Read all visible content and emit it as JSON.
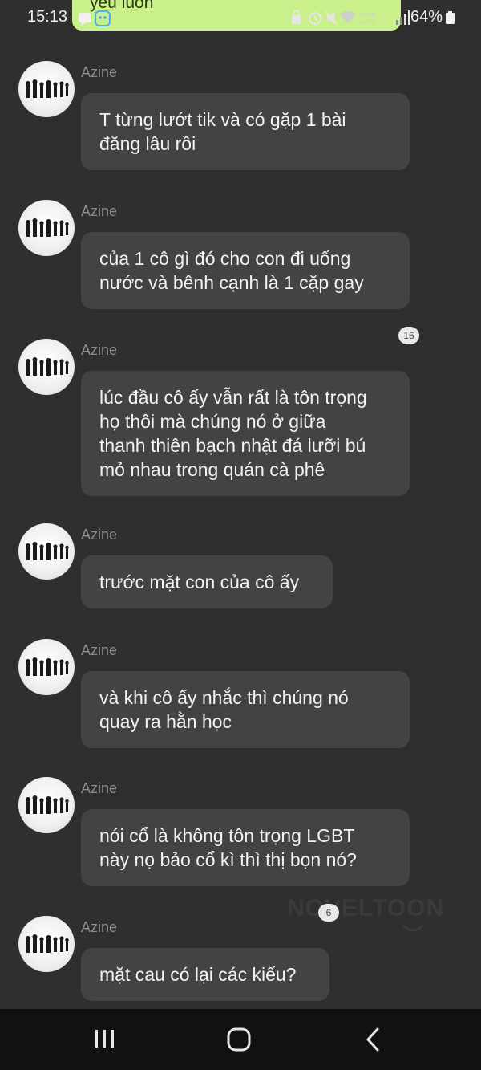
{
  "status_bar": {
    "time": "15:13",
    "banner_text": "yêu luôn",
    "battery": "64%",
    "network_label": "VoLTE2"
  },
  "messages": [
    {
      "sender": "Azine",
      "lines": [
        "T từng lướt tik và có gặp 1 bài",
        "đăng lâu rồi"
      ]
    },
    {
      "sender": "Azine",
      "lines": [
        "của 1 cô gì đó cho con đi uống",
        "nước và bênh cạnh là 1 cặp gay"
      ]
    },
    {
      "sender": "Azine",
      "lines": [
        "lúc đầu cô ấy vẫn rất là tôn trọng",
        "họ thôi mà chúng nó ở giữa",
        "thanh thiên bạch nhật đá lưỡi bú",
        "mỏ nhau trong quán cà phê"
      ],
      "badge": "16"
    },
    {
      "sender": "Azine",
      "lines": [
        "trước mặt con của cô ấy"
      ]
    },
    {
      "sender": "Azine",
      "lines": [
        "và khi cô ấy nhắc thì chúng nó",
        "quay ra hằn học"
      ]
    },
    {
      "sender": "Azine",
      "lines": [
        "nói cổ là không tôn trọng LGBT",
        "này nọ bảo cổ kì thì thị bọn nó?"
      ]
    },
    {
      "sender": "Azine",
      "lines": [
        "mặt cau có lại các kiểu?"
      ],
      "badge": "6"
    }
  ],
  "watermark": "NOVELTOON",
  "icons": {
    "recents": "recents-icon",
    "home": "home-icon",
    "back": "back-icon"
  }
}
